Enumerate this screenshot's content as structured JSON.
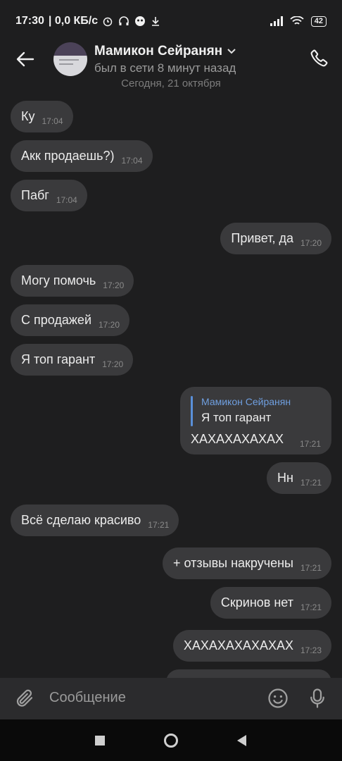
{
  "status_bar": {
    "time": "17:30",
    "speed": "| 0,0 КБ/с",
    "icons": [
      "alarm-icon",
      "headphones-icon",
      "app-icon",
      "download-icon"
    ],
    "signal_icons": [
      "signal-icon",
      "wifi-icon"
    ],
    "battery": "42"
  },
  "header": {
    "contact_name": "Мамикон Сейранян",
    "status": "был в сети 8 минут назад"
  },
  "date_separator": "Сегодня, 21 октября",
  "messages": [
    {
      "text": "Ку",
      "time": "17:04",
      "side": "in"
    },
    {
      "text": "Акк продаешь?)",
      "time": "17:04",
      "side": "in"
    },
    {
      "text": "Пабг",
      "time": "17:04",
      "side": "in"
    },
    {
      "text": "Привет, да",
      "time": "17:20",
      "side": "out"
    },
    {
      "text": "Могу помочь",
      "time": "17:20",
      "side": "in"
    },
    {
      "text": "С продажей",
      "time": "17:20",
      "side": "in"
    },
    {
      "text": "Я топ гарант",
      "time": "17:20",
      "side": "in"
    },
    {
      "text": "Нн",
      "time": "17:21",
      "side": "out"
    },
    {
      "text": "Всё сделаю красиво",
      "time": "17:21",
      "side": "in"
    },
    {
      "text": "+ отзывы накручены",
      "time": "17:21",
      "side": "out"
    },
    {
      "text": "Скринов нет",
      "time": "17:21",
      "side": "out"
    },
    {
      "text": "ХАХАХАХАХАХАХ",
      "time": "17:23",
      "side": "out"
    }
  ],
  "reply_message": {
    "quoted_author": "Мамикон Сейранян",
    "quoted_text": "Я топ гарант",
    "text": "ХАХАХАХАХАХ",
    "time": "17:21"
  },
  "composer": {
    "placeholder": "Сообщение"
  },
  "colors": {
    "background": "#1e1e1f",
    "bubble": "#3a3a3c",
    "accent": "#6f9fe0"
  }
}
